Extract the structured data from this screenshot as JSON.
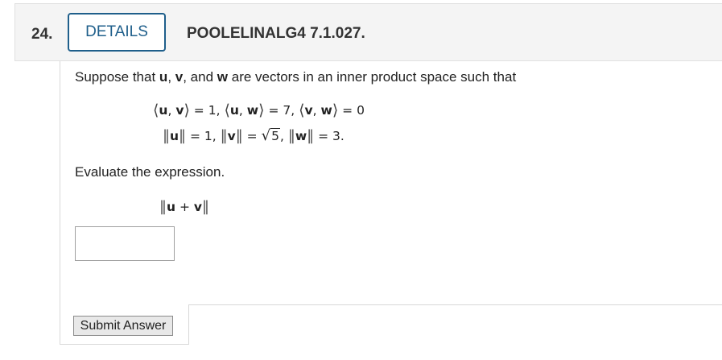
{
  "question": {
    "number": "24.",
    "details_label": "DETAILS",
    "id": "POOLELINALG4 7.1.027."
  },
  "problem": {
    "intro": {
      "t1": "Suppose that ",
      "u": "u",
      "c1": ", ",
      "v": "v",
      "c2": ", and ",
      "w": "w",
      "t2": " are vectors in an inner product space such that"
    },
    "inner_products": [
      {
        "a": "u",
        "b": "v",
        "value": "= 1,"
      },
      {
        "a": "u",
        "b": "w",
        "value": "= 7,"
      },
      {
        "a": "v",
        "b": "w",
        "value": "= 0"
      }
    ],
    "norms": [
      {
        "vec": "u",
        "value": "= 1,"
      },
      {
        "vec": "v",
        "eq": "=",
        "radical": "5",
        "tail": ","
      },
      {
        "vec": "w",
        "value": "= 3."
      }
    ],
    "prompt": "Evaluate the expression.",
    "expression": {
      "a": "u",
      "op": "+",
      "b": "v"
    }
  },
  "answer": {
    "value": "",
    "placeholder": ""
  },
  "submit_label": "Submit Answer"
}
